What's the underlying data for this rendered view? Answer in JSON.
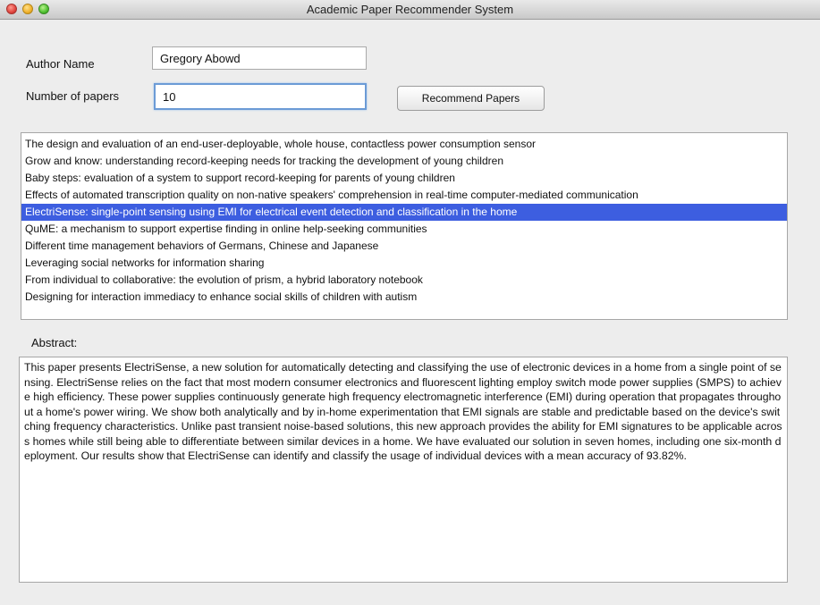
{
  "window": {
    "title": "Academic Paper Recommender System"
  },
  "form": {
    "author_label": "Author Name",
    "author_value": "Gregory Abowd",
    "count_label": "Number of papers",
    "count_value": "10",
    "recommend_button": "Recommend Papers"
  },
  "papers": [
    "The design and evaluation of an end-user-deployable, whole house, contactless power consumption sensor",
    "Grow and know: understanding record-keeping needs for tracking the development of young children",
    "Baby steps: evaluation of a system to support record-keeping for parents of young children",
    "Effects of automated transcription quality on non-native speakers' comprehension in real-time computer-mediated communication",
    "ElectriSense: single-point sensing using EMI for electrical event detection and classification in the home",
    "QuME: a mechanism to support expertise finding in online help-seeking communities",
    "Different time management behaviors of Germans, Chinese and Japanese",
    "Leveraging social networks for information sharing",
    "From individual to collaborative: the evolution of prism, a hybrid laboratory notebook",
    "Designing for interaction immediacy to enhance social skills of children with autism"
  ],
  "selected_index": 4,
  "abstract": {
    "label": "Abstract:",
    "text": "This paper presents ElectriSense, a new solution for automatically detecting and classifying the use of electronic devices in a home from a single point of sensing. ElectriSense relies on the fact that most modern consumer electronics and fluorescent lighting employ switch mode power supplies (SMPS) to achieve high efficiency. These power supplies continuously generate high frequency electromagnetic interference (EMI) during operation that propagates throughout a home's power wiring. We show both analytically and by in-home experimentation that EMI signals are stable and predictable based on the device's switching frequency characteristics. Unlike past transient noise-based solutions, this new approach provides the ability for EMI signatures to be applicable across homes while still being able to differentiate between similar devices in a home. We have evaluated our solution in seven homes, including one six-month deployment. Our results show that ElectriSense can identify and classify the usage of individual devices with a mean accuracy of 93.82%."
  }
}
